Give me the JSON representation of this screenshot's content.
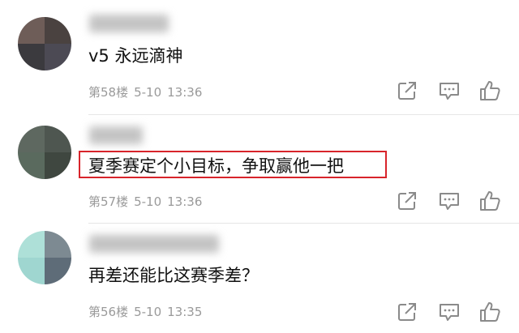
{
  "comments": [
    {
      "text": "v5 永远滴神",
      "floor": "第58楼",
      "date": "5-10",
      "time": "13:36",
      "avatar_colors": [
        "#6e5d58",
        "#4a4240",
        "#3b3a3e",
        "#4c4a54"
      ],
      "highlighted": false
    },
    {
      "text": "夏季赛定个小目标，争取赢他一把",
      "floor": "第57楼",
      "date": "5-10",
      "time": "13:36",
      "avatar_colors": [
        "#5e6860",
        "#4e5650",
        "#5a6a5e",
        "#3f4740"
      ],
      "highlighted": true
    },
    {
      "text": "再差还能比这赛季差？",
      "floor": "第56楼",
      "date": "5-10",
      "time": "13:35",
      "avatar_colors": [
        "#aee0d8",
        "#7d8a92",
        "#9fd6d0",
        "#5e6c78"
      ],
      "highlighted": false
    }
  ],
  "icons": {
    "share": "share-icon",
    "reply": "comment-icon",
    "like": "thumbs-up-icon"
  },
  "colors": {
    "highlight_border": "#d8242b",
    "meta_text": "#9a9a9a",
    "icon": "#8a8a8a"
  }
}
